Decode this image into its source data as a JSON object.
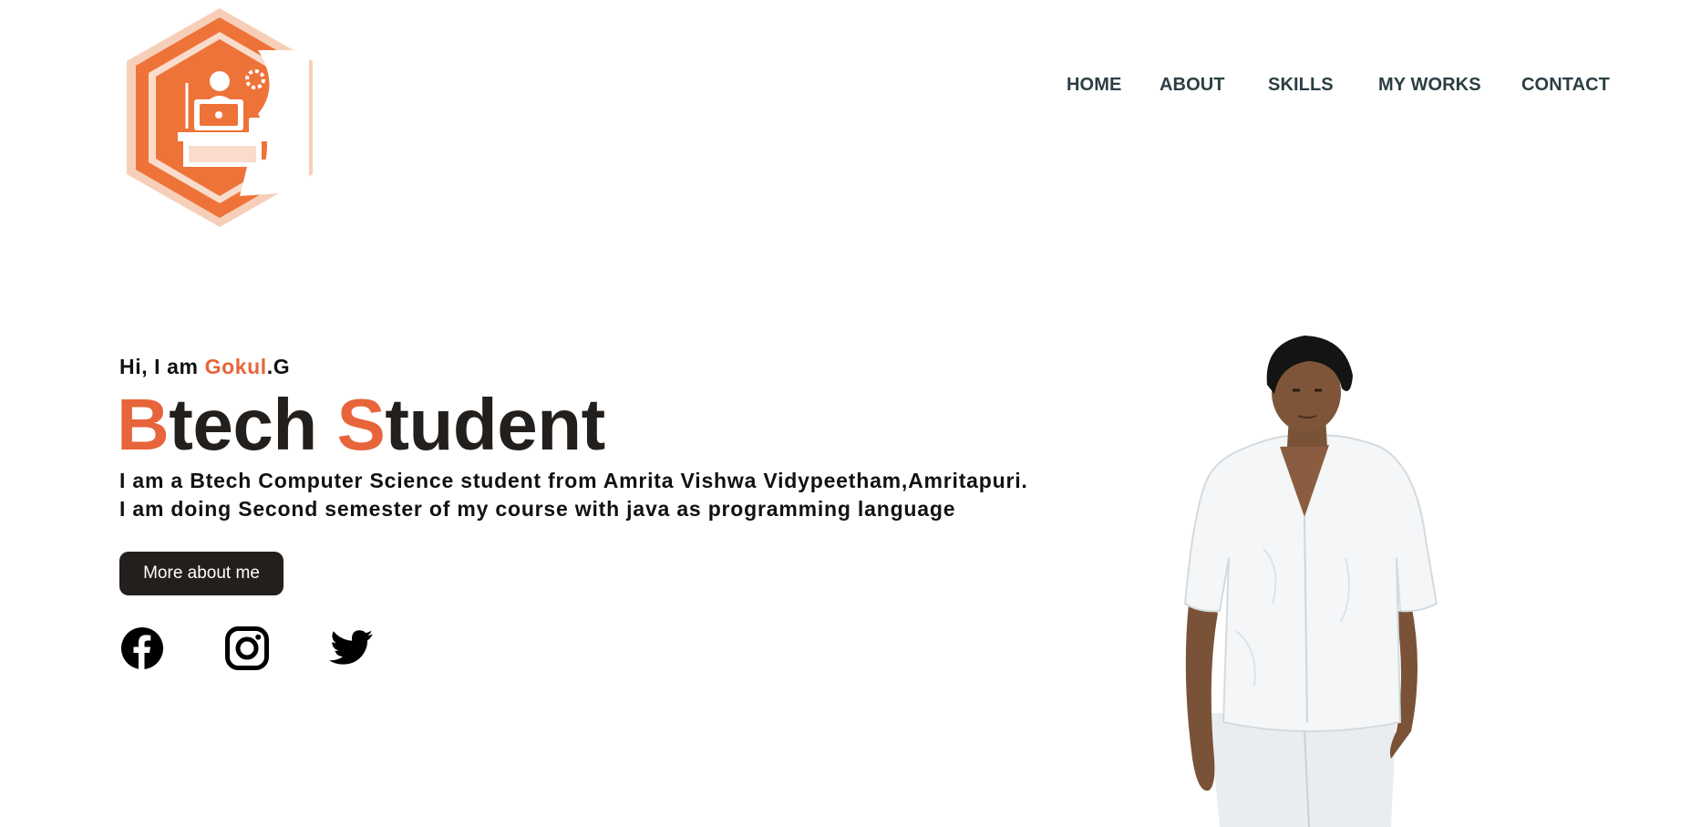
{
  "nav": {
    "items": [
      "HOME",
      "ABOUT",
      "SKILLS",
      "MY WORKS",
      "CONTACT"
    ]
  },
  "hero": {
    "greeting_prefix": "Hi, I am ",
    "name_accent": "Gokul",
    "name_suffix": ".G",
    "headline": {
      "word1_initial": "B",
      "word1_rest": "tech ",
      "word2_initial": "S",
      "word2_rest": "tudent"
    },
    "description_lines": [
      "I am a Btech Computer Science student from Amrita Vishwa Vidypeetham,Amritapuri.",
      "I am doing Second semester of my course with java as programming language"
    ],
    "button_label": "More about me"
  },
  "social": [
    "facebook-icon",
    "instagram-icon",
    "twitter-icon"
  ],
  "colors": {
    "accent": "#e8643a",
    "dark": "#231f1c",
    "nav": "#2c3e44"
  }
}
